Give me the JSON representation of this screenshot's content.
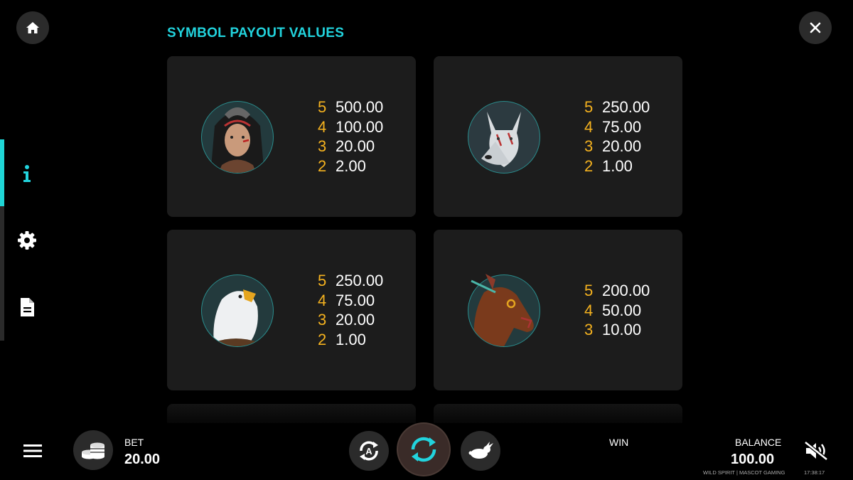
{
  "title": "SYMBOL PAYOUT VALUES",
  "cards": [
    {
      "symbol": "woman-warrior",
      "payouts": [
        {
          "count": "5",
          "value": "500.00"
        },
        {
          "count": "4",
          "value": "100.00"
        },
        {
          "count": "3",
          "value": "20.00"
        },
        {
          "count": "2",
          "value": "2.00"
        }
      ]
    },
    {
      "symbol": "wolf",
      "payouts": [
        {
          "count": "5",
          "value": "250.00"
        },
        {
          "count": "4",
          "value": "75.00"
        },
        {
          "count": "3",
          "value": "20.00"
        },
        {
          "count": "2",
          "value": "1.00"
        }
      ]
    },
    {
      "symbol": "eagle",
      "payouts": [
        {
          "count": "5",
          "value": "250.00"
        },
        {
          "count": "4",
          "value": "75.00"
        },
        {
          "count": "3",
          "value": "20.00"
        },
        {
          "count": "2",
          "value": "1.00"
        }
      ]
    },
    {
      "symbol": "horse",
      "payouts": [
        {
          "count": "5",
          "value": "200.00"
        },
        {
          "count": "4",
          "value": "50.00"
        },
        {
          "count": "3",
          "value": "10.00"
        }
      ]
    }
  ],
  "bottom": {
    "bet_label": "BET",
    "bet_value": "20.00",
    "win_label": "WIN",
    "balance_label": "BALANCE",
    "balance_value": "100.00",
    "game_credit": "WILD SPIRIT | MASCOT GAMING",
    "clock": "17:38:17",
    "autoplay_letter": "A"
  },
  "colors": {
    "accent": "#22d3dd",
    "count": "#f5b21f",
    "card": "#1c1c1c"
  }
}
